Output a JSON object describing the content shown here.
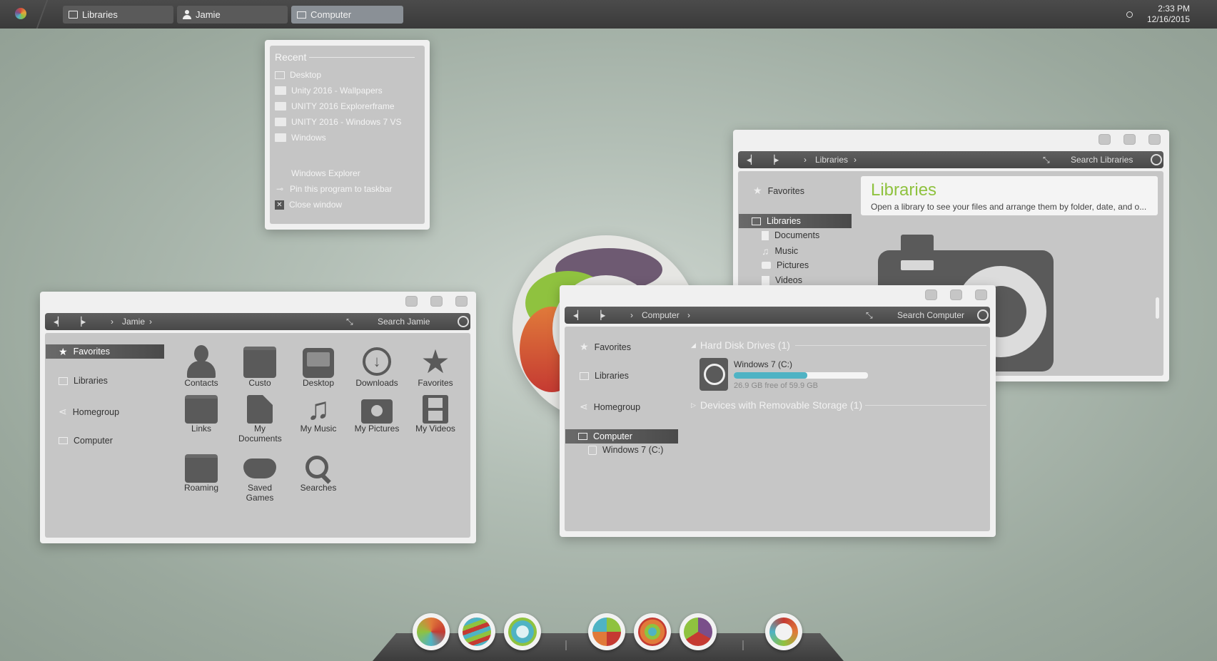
{
  "taskbar": {
    "buttons": [
      {
        "label": "Libraries",
        "icon": "book-icon"
      },
      {
        "label": "Jamie",
        "icon": "user-icon"
      },
      {
        "label": "Computer",
        "icon": "monitor-icon"
      }
    ],
    "time": "2:33 PM",
    "date": "12/16/2015"
  },
  "jumplist": {
    "recent_title": "Recent",
    "recent_items": [
      "Desktop",
      "Unity 2016 - Wallpapers",
      "UNITY 2016 Explorerframe",
      "UNITY 2016 - Windows 7 VS",
      "Windows"
    ],
    "tasks": [
      "Windows Explorer",
      "Pin this program to taskbar",
      "Close window"
    ]
  },
  "jamie_window": {
    "path": "Jamie",
    "search_placeholder": "Search Jamie",
    "nav": [
      "Favorites",
      "Libraries",
      "Homegroup",
      "Computer"
    ],
    "items": [
      "Contacts",
      "Custo",
      "Desktop",
      "Downloads",
      "Favorites",
      "Links",
      "My Documents",
      "My Music",
      "My Pictures",
      "My Videos",
      "Roaming",
      "Saved Games",
      "Searches"
    ]
  },
  "libraries_window": {
    "path": "Libraries",
    "search_placeholder": "Search Libraries",
    "nav": {
      "favorites": "Favorites",
      "libraries": "Libraries",
      "children": [
        "Documents",
        "Music",
        "Pictures",
        "Videos"
      ]
    },
    "title": "Libraries",
    "subtitle": "Open a library to see your files and arrange them by folder, date, and o..."
  },
  "computer_window": {
    "path": "Computer",
    "search_placeholder": "Search Computer",
    "nav": [
      "Favorites",
      "Libraries",
      "Homegroup",
      "Computer",
      "Windows 7 (C:)"
    ],
    "group_hdd": "Hard Disk Drives (1)",
    "drive_name": "Windows 7 (C:)",
    "drive_free": "26.9 GB free of 59.9 GB",
    "drive_used_fraction": 0.55,
    "group_removable": "Devices with Removable Storage (1)"
  },
  "colors": {
    "accent_green": "#8fc23f",
    "progress": "#4fb3c4",
    "taskbar": "#3f3f3f"
  }
}
